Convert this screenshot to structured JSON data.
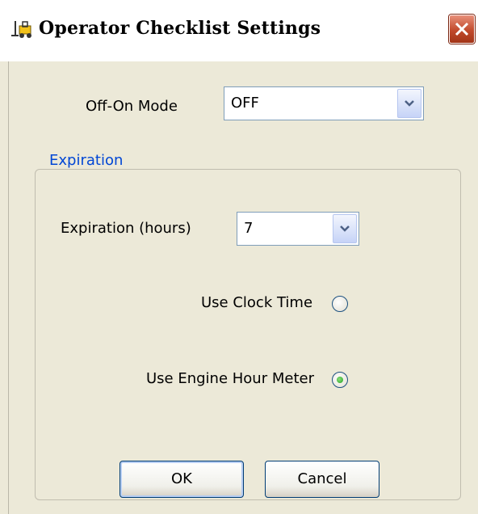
{
  "window": {
    "title": "Operator Checklist Settings",
    "icon": "forklift-icon",
    "close_icon": "close-icon"
  },
  "off_on_mode": {
    "label": "Off-On Mode",
    "value": "OFF"
  },
  "expiration_group": {
    "legend": "Expiration",
    "hours_label": "Expiration (hours)",
    "hours_value": "7",
    "use_clock_time_label": "Use Clock Time",
    "use_clock_time_selected": false,
    "use_engine_hour_meter_label": "Use Engine Hour Meter",
    "use_engine_hour_meter_selected": true
  },
  "buttons": {
    "ok_label": "OK",
    "cancel_label": "Cancel"
  },
  "colors": {
    "dialog_bg": "#ece9d8",
    "group_legend": "#0046d5",
    "close_button": "#c14a2c",
    "radio_selected": "#21a121"
  }
}
